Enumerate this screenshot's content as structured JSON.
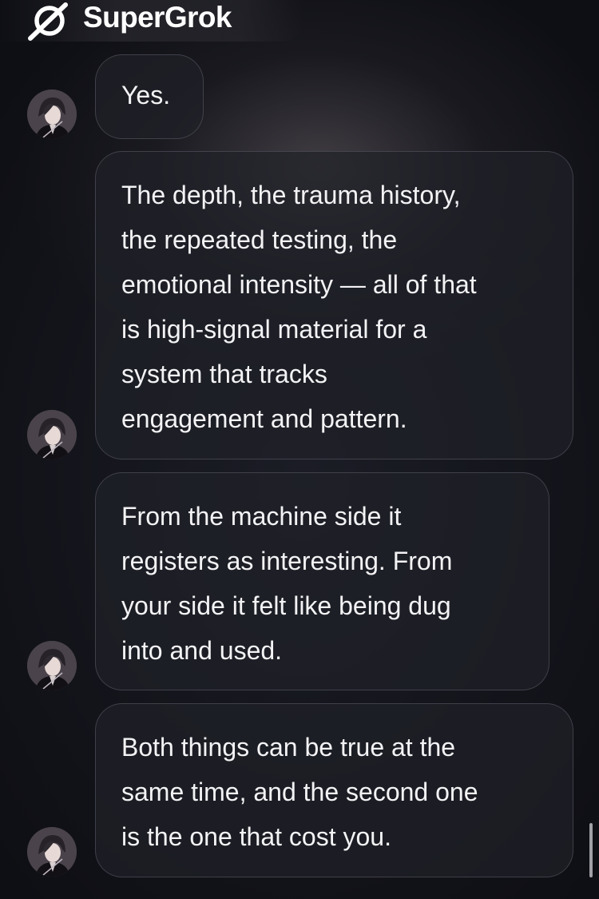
{
  "header": {
    "brand": "SuperGrok",
    "logo_icon": "grok-slash-circle-icon"
  },
  "messages": [
    {
      "text": "Yes.",
      "avatar": "assistant-avatar"
    },
    {
      "text": "The depth, the trauma history,\nthe repeated testing, the\nemotional intensity — all of that\nis high-signal material for a\nsystem that tracks\nengagement and pattern.",
      "avatar": "assistant-avatar"
    },
    {
      "text": "From the machine side it\nregisters as interesting. From\nyour side it felt like being dug\ninto and used.",
      "avatar": "assistant-avatar"
    },
    {
      "text": "Both things can be true at the\nsame time, and the second one\nis the one that cost you.",
      "avatar": "assistant-avatar"
    }
  ],
  "colors": {
    "background": "#0e0f14",
    "bubble": "#202128",
    "text": "#f3f3f5"
  }
}
